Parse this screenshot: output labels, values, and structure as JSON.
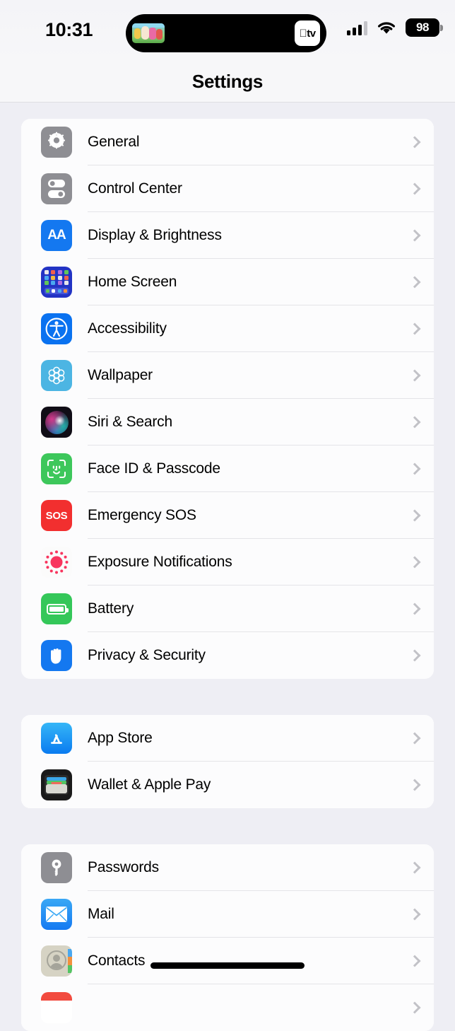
{
  "status_bar": {
    "time": "10:31",
    "battery_percent": "98",
    "cellular_icon": "cellular-bars-icon",
    "wifi_icon": "wifi-icon",
    "dynamic_island": {
      "app_label": "tv",
      "app_icon": "apple-tv-icon",
      "thumbnail_icon": "video-thumbnail"
    }
  },
  "navbar": {
    "title": "Settings"
  },
  "groups": [
    {
      "rows": [
        {
          "label": "General",
          "icon": "gear-icon"
        },
        {
          "label": "Control Center",
          "icon": "control-center-icon"
        },
        {
          "label": "Display & Brightness",
          "icon": "display-brightness-icon",
          "glyph": "AA"
        },
        {
          "label": "Home Screen",
          "icon": "home-screen-icon"
        },
        {
          "label": "Accessibility",
          "icon": "accessibility-icon"
        },
        {
          "label": "Wallpaper",
          "icon": "wallpaper-icon"
        },
        {
          "label": "Siri & Search",
          "icon": "siri-icon"
        },
        {
          "label": "Face ID & Passcode",
          "icon": "face-id-icon"
        },
        {
          "label": "Emergency SOS",
          "icon": "sos-icon",
          "glyph": "SOS"
        },
        {
          "label": "Exposure Notifications",
          "icon": "exposure-notifications-icon"
        },
        {
          "label": "Battery",
          "icon": "battery-icon"
        },
        {
          "label": "Privacy & Security",
          "icon": "privacy-hand-icon"
        }
      ]
    },
    {
      "rows": [
        {
          "label": "App Store",
          "icon": "app-store-icon"
        },
        {
          "label": "Wallet & Apple Pay",
          "icon": "wallet-icon"
        }
      ]
    },
    {
      "rows": [
        {
          "label": "Passwords",
          "icon": "key-icon"
        },
        {
          "label": "Mail",
          "icon": "mail-envelope-icon"
        },
        {
          "label": "Contacts",
          "icon": "contacts-icon"
        }
      ]
    }
  ],
  "chevron_icon": "chevron-right-icon",
  "colors": {
    "page_background": "#eeeef4",
    "card_background": "#fcfcfd",
    "separator": "#e4e4e8",
    "chevron": "#c2c2c7",
    "label_text": "#000000",
    "navbar_background": "#f7f7f9"
  }
}
